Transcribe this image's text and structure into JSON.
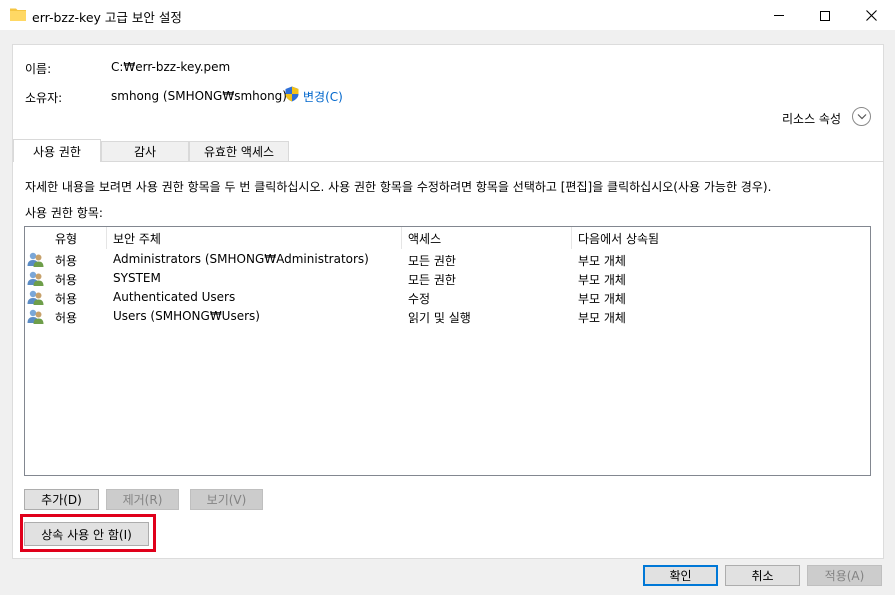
{
  "window": {
    "title": "err-bzz-key 고급 보안 설정",
    "folder_icon_color": "#f5c542"
  },
  "info": {
    "name_label": "이름:",
    "name_value": "C:₩err-bzz-key.pem",
    "owner_label": "소유자:",
    "owner_value": "smhong (SMHONG₩smhong)",
    "change_link": "변경(C)",
    "resource_properties": "리소스 속성"
  },
  "tabs": [
    {
      "label": "사용 권한",
      "active": true
    },
    {
      "label": "감사",
      "active": false
    },
    {
      "label": "유효한 액세스",
      "active": false
    }
  ],
  "instructions": "자세한 내용을 보려면 사용 권한 항목을 두 번 클릭하십시오. 사용 권한 항목을 수정하려면 항목을 선택하고 [편집]을 클릭하십시오(사용 가능한 경우).",
  "entries_label": "사용 권한 항목:",
  "columns": [
    "유형",
    "보안 주체",
    "액세스",
    "다음에서 상속됨"
  ],
  "rows": [
    {
      "type": "허용",
      "principal": "Administrators (SMHONG₩Administrators)",
      "access": "모든 권한",
      "inherited": "부모 개체"
    },
    {
      "type": "허용",
      "principal": "SYSTEM",
      "access": "모든 권한",
      "inherited": "부모 개체"
    },
    {
      "type": "허용",
      "principal": "Authenticated Users",
      "access": "수정",
      "inherited": "부모 개체"
    },
    {
      "type": "허용",
      "principal": "Users (SMHONG₩Users)",
      "access": "읽기 및 실행",
      "inherited": "부모 개체"
    }
  ],
  "buttons": {
    "add": "추가(D)",
    "remove": "제거(R)",
    "view": "보기(V)",
    "disable_inheritance": "상속 사용 안 함(I)",
    "ok": "확인",
    "cancel": "취소",
    "apply": "적용(A)"
  },
  "colors": {
    "link": "#0066cc",
    "highlight": "#e0001b",
    "default_button_border": "#0078d7"
  }
}
